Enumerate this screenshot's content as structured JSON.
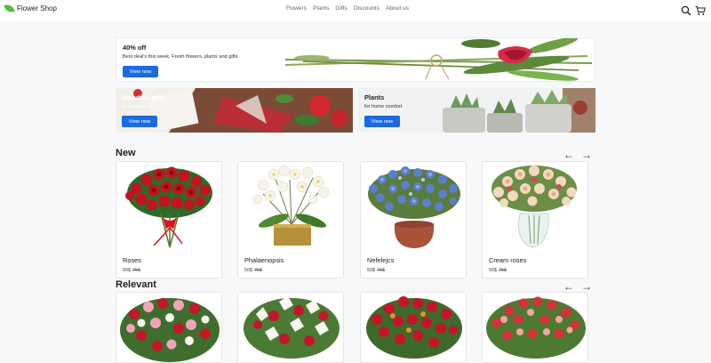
{
  "header": {
    "brand": "Flower Shop",
    "nav": [
      "Flowers",
      "Plants",
      "Gifts",
      "Discounts",
      "About us"
    ],
    "icons": [
      "search-icon",
      "cart-icon"
    ]
  },
  "banners": {
    "main": {
      "title": "40% off",
      "subtitle": "Best deal's this week. Fresh flowers, plants and gifts",
      "button": "View now"
    },
    "gifts": {
      "title": "Beautiful gifts",
      "subtitle": "for loved ones",
      "button": "View now"
    },
    "plants": {
      "title": "Plants",
      "subtitle": "for home comfort",
      "button": "View now"
    }
  },
  "sections": {
    "new": {
      "title": "New",
      "products": [
        {
          "name": "Roses",
          "price": "50$",
          "old_price": "75$"
        },
        {
          "name": "Phalaenopsis",
          "price": "50$",
          "old_price": "75$"
        },
        {
          "name": "Nefelejcs",
          "price": "50$",
          "old_price": "75$"
        },
        {
          "name": "Cream roses",
          "price": "50$",
          "old_price": "75$"
        }
      ]
    },
    "relevant": {
      "title": "Relevant"
    }
  },
  "arrows": {
    "prev": "←",
    "next": "→"
  },
  "colors": {
    "accent": "#1a6ae0",
    "brand": "#58b93f",
    "background": "#f7f8fa"
  }
}
